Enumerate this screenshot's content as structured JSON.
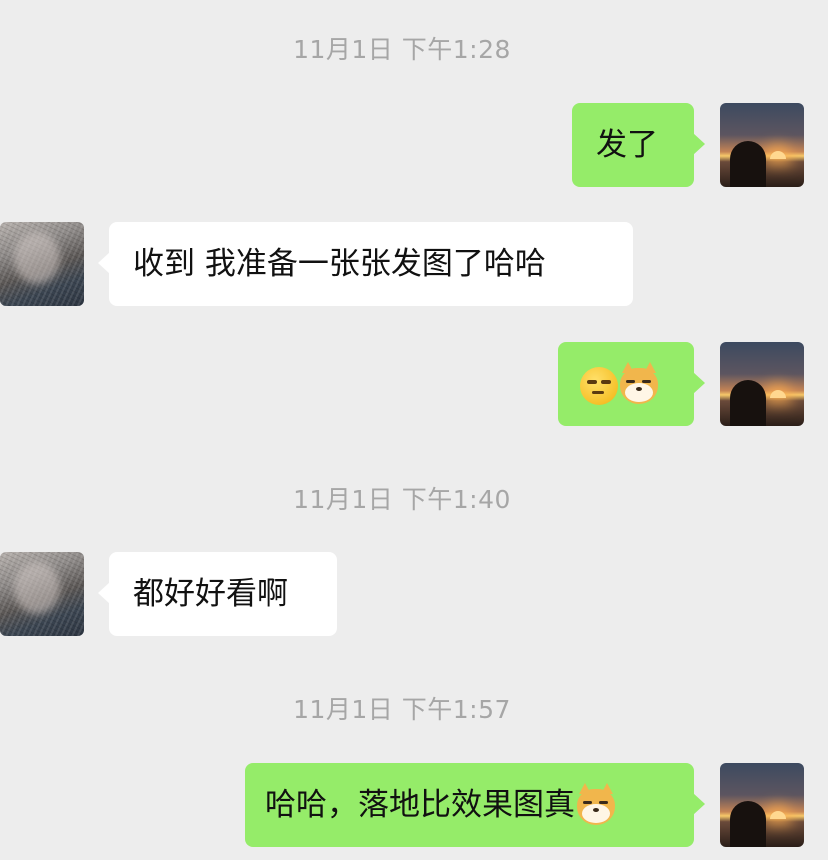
{
  "timestamps": [
    "11月1日 下午1:28",
    "11月1日 下午1:40",
    "11月1日 下午1:57"
  ],
  "messages": [
    {
      "sender": "self",
      "text": "发了"
    },
    {
      "sender": "other",
      "text": "收到 我准备一张张发图了哈哈"
    },
    {
      "sender": "self",
      "text": "",
      "emojis": [
        "smirk-face-emoji",
        "doge-emoji"
      ]
    },
    {
      "sender": "other",
      "text": "都好好看啊"
    },
    {
      "sender": "self",
      "text": "哈哈，落地比效果图真",
      "emojis": [
        "doge-emoji"
      ]
    }
  ],
  "colors": {
    "background": "#ededed",
    "self_bubble": "#95ec69",
    "other_bubble": "#ffffff",
    "timestamp_text": "#a6a6a6"
  }
}
